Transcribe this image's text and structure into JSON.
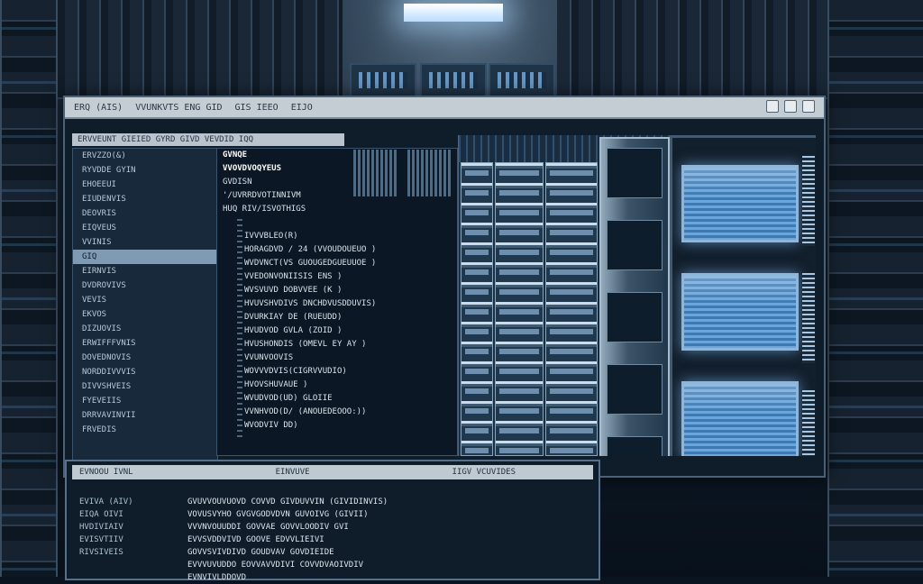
{
  "monitor": {
    "title_segments": [
      "ERQ (AIS)",
      "VVUNKVTS ENG GID",
      "GIS IEEO",
      "EIJO"
    ],
    "tab_bar": "ERVVEUNT GIEIED GYRD GIVD VEVDID IQQ",
    "tree_items": [
      "ERVZZO(&)",
      "RYVDDE GYIN",
      "EHOEEUI",
      "EIUDENVIS",
      "DEOVRIS",
      "EIQVEUS",
      "VVINIS",
      "GIQ",
      "EIRNVIS",
      "DVDROVIVS",
      "VEVIS",
      "EKVOS",
      "DIZUOVIS",
      "ERWIFFFVNIS",
      "DOVEDNOVIS",
      "NORDDIVVVIS",
      "DIVVSHVEIS",
      "FYEVEIIS",
      "DRRVAVINVII",
      "FRVEDIS"
    ],
    "selected_tree_item": 7,
    "code_lines": [
      "GVDISN",
      "'/UVRRDVOTINNIVM",
      "HUQ RIV/ISVOTHIGS",
      "",
      "IVVVBLEO(R)",
      "HORAGDVD / 24 (VVOUDOUEUO )",
      "WVDVNCT(VS GUOUGEDGUEUUOE )",
      "VVEDONVONIISIS ENS )",
      "WVSVUVD DOBVVEE (K )",
      "HVUVSHVDIVS DNCHDVUSDDUVIS)",
      "DVURKIAY DE (RUEUDD)",
      "HVUDVOD GVLA (ZOID )",
      "HVUSHONDIS (OMEVL EY AY )",
      "VVUNVOOVIS",
      "WOVVVDVIS(CIGRVVUDIO)",
      "HVOVSHUVAUE )",
      "WVUDVOD(UD) GLOIIE",
      "VVNHVOD(D/ (ANOUEDEOOO:))",
      "WVODVIV DD)"
    ],
    "header_lines": [
      "GVNQE",
      "VVOVDVOQYEUS"
    ]
  },
  "bottom_monitor": {
    "title_segments": [
      "EVNOOU IVNL",
      "EINVUVE",
      "IIGV VCUVIDES"
    ],
    "left_lines": [
      "EVIVA (AIV)",
      "EIQA OIVI",
      "HVDIVIAIV",
      "EVISVTIIV",
      "RIVSIVEIS"
    ],
    "right_lines": [
      "GVUVVOUVUOVD COVVD GIVDUVVIN (GIVIDINVIS)",
      "VOVUSVYHO GVGVGODVDVN GUVOIVG (GIVII)",
      "VVVNVOUUDDI GOVVAE GOVVLOODIV GVI",
      "EVVSVDDVIVD GOOVE EDVVLIEIVI",
      "GOVVSVIVDIVD GOUDVAV GOVDIEIDE",
      "EVVVUVUDDO EOVVAVVDIVI COVVDVAOIVDIV",
      "EVNVIVLDDOVD"
    ]
  },
  "colors": {
    "screen_glow": "#6aa6dc",
    "titlebar": "#c4ccd4",
    "panel_bg": "#0b1724"
  }
}
